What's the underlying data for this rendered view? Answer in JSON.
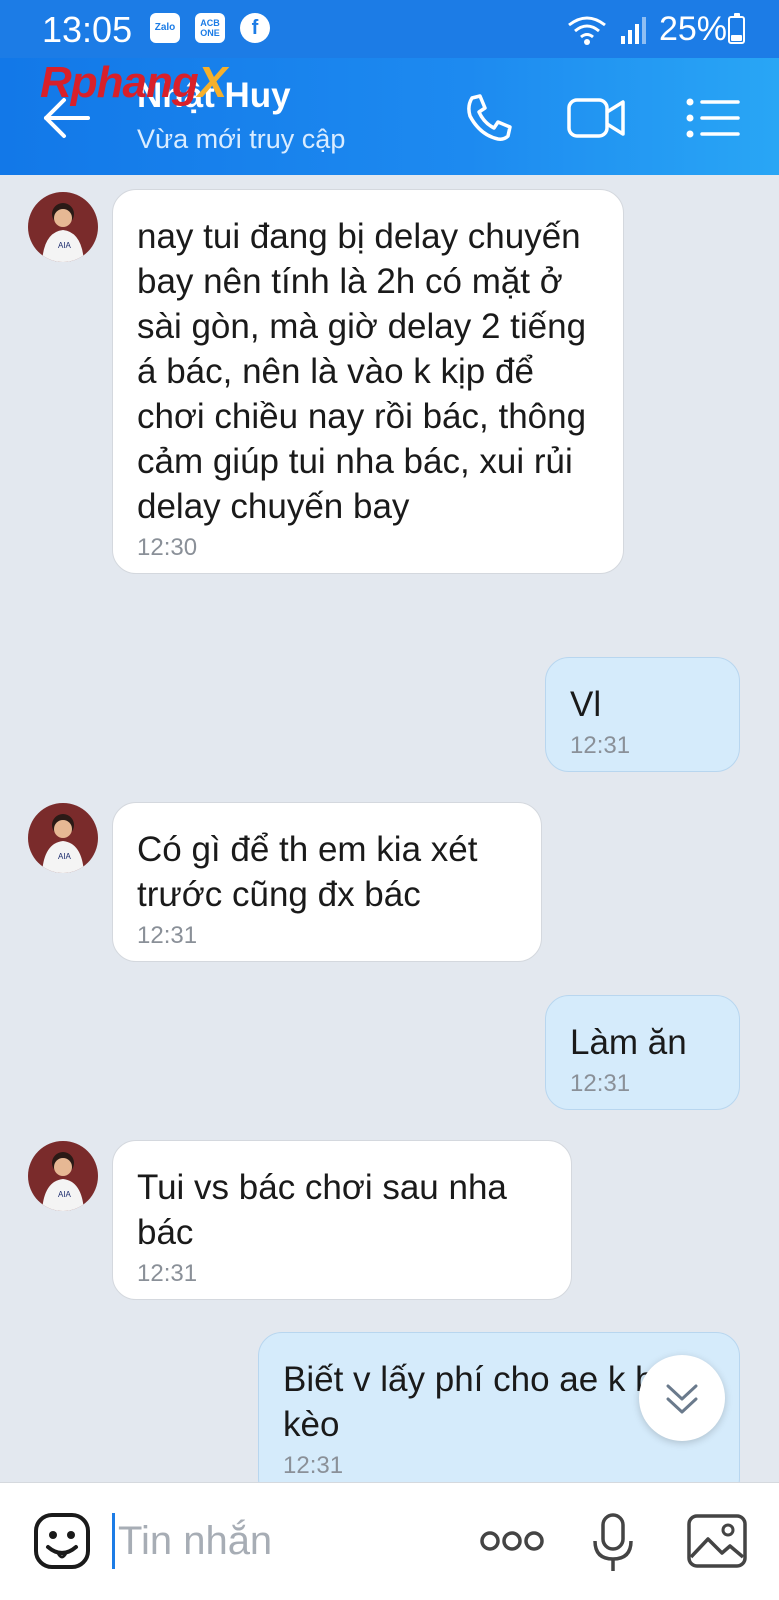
{
  "status_bar": {
    "time": "13:05",
    "apps": [
      "Zalo",
      "ACB ONE",
      "f"
    ],
    "battery": "25%",
    "battery_level": 0.25,
    "icons": [
      "wifi-icon",
      "signal-icon",
      "battery-icon"
    ]
  },
  "header": {
    "watermark_main": "Rphang",
    "watermark_x": "X",
    "contact_name": "Nhật Huy",
    "contact_status": "Vừa mới truy cập",
    "icons": [
      "back-arrow-icon",
      "phone-icon",
      "video-call-icon",
      "menu-list-icon"
    ]
  },
  "messages": [
    {
      "dir": "in",
      "text": "nay tui đang bị delay chuyến bay nên tính là 2h có mặt ở sài gòn, mà giờ delay 2 tiếng á bác, nên là vào k kịp để chơi chiều nay rồi bác, thông cảm giúp tui nha bác, xui rủi delay chuyến bay",
      "time": "12:30"
    },
    {
      "dir": "out",
      "text": "Vl",
      "time": "12:31"
    },
    {
      "dir": "in",
      "text": "Có gì để th em kia xét trước cũng đx bác",
      "time": "12:31"
    },
    {
      "dir": "out",
      "text": "Làm ăn",
      "time": "12:31"
    },
    {
      "dir": "in",
      "text": "Tui vs bác chơi sau nha bác",
      "time": "12:31"
    },
    {
      "dir": "out",
      "text": "Biết v lấy phí cho ae k bùm kèo",
      "time": "12:31"
    }
  ],
  "composer": {
    "placeholder": "Tin nhắn",
    "icons": [
      "emoji-icon",
      "more-icon",
      "microphone-icon",
      "image-icon"
    ]
  },
  "colors": {
    "header_blue": "#1c7ce6",
    "out_bubble": "#d5ebfb",
    "in_bubble": "#ffffff",
    "chat_bg": "#e3e8ef"
  }
}
